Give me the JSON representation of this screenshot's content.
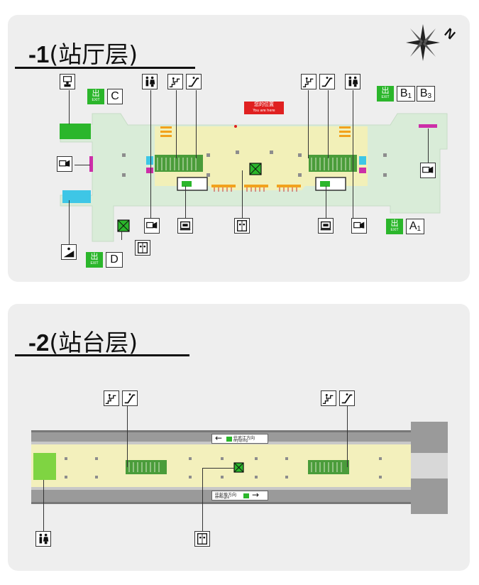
{
  "level1": {
    "title_num": "-1",
    "title_text": "(站厅层)",
    "exits": {
      "C": {
        "mark": "出",
        "sub": "EXIT",
        "letter": "C"
      },
      "B": {
        "mark": "出",
        "sub": "EXIT",
        "letter1": "B",
        "sub1": "1",
        "letter2": "B",
        "sub2": "3"
      },
      "A": {
        "mark": "出",
        "sub": "1",
        "letter": "A"
      },
      "D": {
        "mark": "出",
        "sub": "EXIT",
        "letter": "D"
      }
    },
    "you_are_here": {
      "cn": "您的位置",
      "en": "You are here"
    },
    "icons": [
      "ticket-office-icon",
      "restroom-icon",
      "stairs-icon",
      "escalator-icon",
      "ticket-machine-icon",
      "elevator-icon",
      "service-center-icon",
      "fare-gate-icon"
    ]
  },
  "level2": {
    "title_num": "-2",
    "title_text": "(站台层)",
    "direction_west": {
      "cn": "往武江方向",
      "en": "to Jiujiang",
      "arrow": "←"
    },
    "direction_east": {
      "cn": "往彭埠方向",
      "en": "to Pengbu",
      "arrow": "→"
    }
  },
  "compass": {
    "letter": "N"
  },
  "colors": {
    "concourse": "#d9ecd8",
    "paid_area": "#f2f0b8",
    "platform_edge": "#aaaaaa",
    "platform": "#f3f0bc",
    "exit_green": "#2bb62b",
    "exit_cyan": "#3ec6e6",
    "escalator": "#4a9c3a",
    "accent_magenta": "#cc2fa8",
    "you_here_red": "#e02020"
  }
}
